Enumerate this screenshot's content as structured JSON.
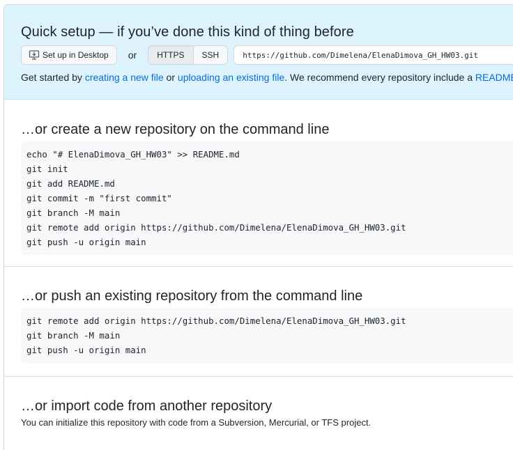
{
  "quick_setup": {
    "title": "Quick setup — if you’ve done this kind of thing before",
    "desktop_button": "Set up in Desktop",
    "or": "or",
    "https_label": "HTTPS",
    "ssh_label": "SSH",
    "clone_url": "https://github.com/Dimelena/ElenaDimova_GH_HW03.git",
    "help_prefix": "Get started by ",
    "help_link_create": "creating a new file",
    "help_or": " or ",
    "help_link_upload": "uploading an existing file",
    "help_middle": ". We recommend every repository include a ",
    "help_link_readme": "README,"
  },
  "cmdline_section": {
    "title": "…or create a new repository on the command line",
    "lines": [
      "echo \"# ElenaDimova_GH_HW03\" >> README.md",
      "git init",
      "git add README.md",
      "git commit -m \"first commit\"",
      "git branch -M main",
      "git remote add origin https://github.com/Dimelena/ElenaDimova_GH_HW03.git",
      "git push -u origin main"
    ]
  },
  "push_section": {
    "title": "…or push an existing repository from the command line",
    "lines": [
      "git remote add origin https://github.com/Dimelena/ElenaDimova_GH_HW03.git",
      "git branch -M main",
      "git push -u origin main"
    ]
  },
  "import_section": {
    "title": "…or import code from another repository",
    "note": "You can initialize this repository with code from a Subversion, Mercurial, or TFS project."
  },
  "icons": {
    "desktop": "desktop-download-icon"
  },
  "colors": {
    "quick_setup_bg": "#ddf4ff",
    "link": "#0969da",
    "code_bg": "#f6f8fa"
  }
}
